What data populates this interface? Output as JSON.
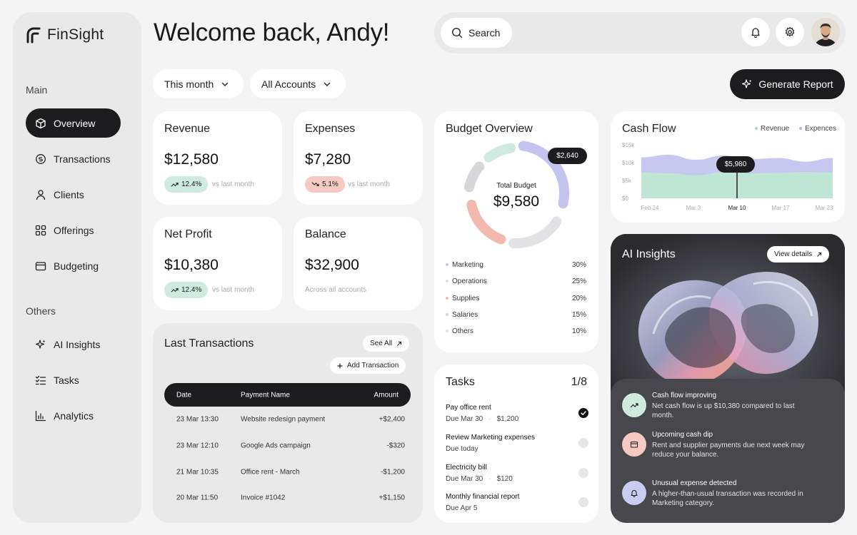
{
  "app": {
    "name": "FinSight"
  },
  "sidebar": {
    "main_label": "Main",
    "others_label": "Others",
    "main_items": [
      {
        "label": "Overview",
        "icon": "cube-icon",
        "active": true
      },
      {
        "label": "Transactions",
        "icon": "coin-icon"
      },
      {
        "label": "Clients",
        "icon": "user-icon"
      },
      {
        "label": "Offerings",
        "icon": "grid-icon"
      },
      {
        "label": "Budgeting",
        "icon": "wallet-icon"
      }
    ],
    "other_items": [
      {
        "label": "AI Insights",
        "icon": "sparkle-icon"
      },
      {
        "label": "Tasks",
        "icon": "checklist-icon"
      },
      {
        "label": "Analytics",
        "icon": "bar-chart-icon"
      }
    ]
  },
  "header": {
    "welcome": "Welcome back, Andy!",
    "search_label": "Search",
    "period_filter": "This month",
    "account_filter": "All Accounts",
    "generate_label": "Generate Report"
  },
  "stats": {
    "revenue": {
      "title": "Revenue",
      "value": "$12,580",
      "change": "12.4%",
      "note": "vs last month"
    },
    "expenses": {
      "title": "Expenses",
      "value": "$7,280",
      "change": "5.1%",
      "note": "vs last month"
    },
    "net_profit": {
      "title": "Net Profit",
      "value": "$10,380",
      "change": "12.4%",
      "note": "vs last month"
    },
    "balance": {
      "title": "Balance",
      "value": "$32,900",
      "note": "Across all accounts"
    }
  },
  "transactions": {
    "title": "Last Transactions",
    "see_all": "See All",
    "add": "Add Transaction",
    "columns": [
      "Date",
      "Payment Name",
      "Amount"
    ],
    "rows": [
      {
        "date": "23 Mar 13:30",
        "name": "Website redesign payment",
        "amount": "+$2,400"
      },
      {
        "date": "23 Mar 12:10",
        "name": "Google Ads campaign",
        "amount": "-$320"
      },
      {
        "date": "21 Mar 10:35",
        "name": "Office rent - March",
        "amount": "-$1,200"
      },
      {
        "date": "20 Mar 11:50",
        "name": "Invoice #1042",
        "amount": "+$1,150"
      }
    ]
  },
  "budget": {
    "title": "Budget Overview",
    "total_label": "Total Budget",
    "total_value": "$9,580",
    "tooltip": "$2,640",
    "categories": [
      {
        "name": "Marketing",
        "pct": "30%",
        "color": "#c3c5ef"
      },
      {
        "name": "Operations",
        "pct": "25%",
        "color": "#cfeadf"
      },
      {
        "name": "Supplies",
        "pct": "20%",
        "color": "#f4b9ae"
      },
      {
        "name": "Salaries",
        "pct": "15%",
        "color": "#d7d7d9"
      },
      {
        "name": "Others",
        "pct": "10%",
        "color": "#cfeadf"
      }
    ]
  },
  "tasks": {
    "title": "Tasks",
    "count": "1/8",
    "items": [
      {
        "name": "Pay office rent",
        "due": "Due Mar 30",
        "amount": "$1,200",
        "done": true
      },
      {
        "name": "Review Marketing expenses",
        "due": "Due today",
        "amount": "",
        "done": false
      },
      {
        "name": "Electricity bill",
        "due": "Due Mar 30",
        "amount": "$120",
        "done": false
      },
      {
        "name": "Monthly financial report",
        "due": "Due Apr 5",
        "amount": "",
        "done": false
      }
    ]
  },
  "chart_data": {
    "type": "area",
    "title": "Cash Flow",
    "x": [
      "Feb 24",
      "Mar 3",
      "Mar 10",
      "Mar 17",
      "Mar 23"
    ],
    "y_ticks": [
      "$15k",
      "$10k",
      "$5k",
      "$0"
    ],
    "ylim": [
      0,
      15000
    ],
    "series": [
      {
        "name": "Revenue",
        "color": "#bfe6d4",
        "values": [
          7200,
          7000,
          6500,
          7300,
          7000,
          7100,
          7400,
          7200
        ]
      },
      {
        "name": "Expences",
        "color": "#c6c8ef",
        "values": [
          11500,
          12200,
          10800,
          12000,
          11000,
          11300,
          10300,
          11300
        ]
      }
    ],
    "highlight": {
      "x": "Mar 10",
      "label": "$5,980"
    },
    "legend_position": "top-right"
  },
  "ai": {
    "title": "AI Insights",
    "view_details": "View details",
    "items": [
      {
        "title": "Cash flow improving",
        "body": "Net cash flow is up $10,380 compared to last month.",
        "icon": "trend-up-icon",
        "color": "#cfeadf"
      },
      {
        "title": "Upcoming cash dip",
        "body": "Rent and supplier payments due next week may reduce your balance.",
        "icon": "wallet-icon",
        "color": "#f6c9c3"
      },
      {
        "title": "Unusual expense detected",
        "body": "A higher-than-usual transaction was recorded in Marketing category.",
        "icon": "bell-icon",
        "color": "#c9cbef"
      }
    ]
  }
}
